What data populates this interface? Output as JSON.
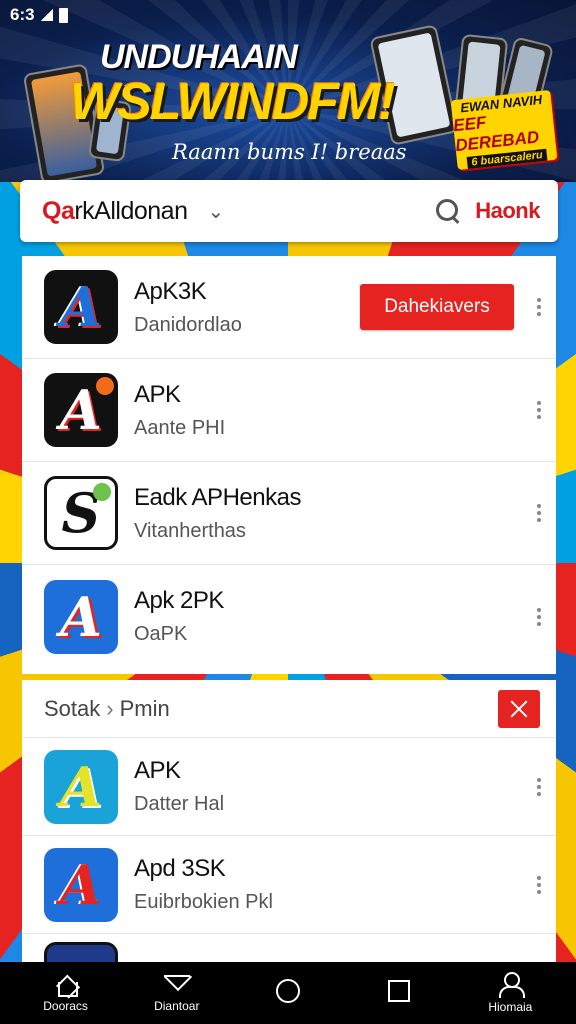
{
  "status_bar": {
    "time": "6:3"
  },
  "banner": {
    "title": "UNDUHAAIN",
    "headline": "WSLWINDFM!",
    "subtitle": "Raann bums I! breaas",
    "badge": {
      "line1": "EWAN NAVIH",
      "line2": "EEF DEREBAD",
      "line3": "6 buarscaleru"
    }
  },
  "search_bar": {
    "brand_red": "Qa",
    "brand_rest": "rkAlldonan",
    "action_label": "Haonk"
  },
  "apps_top": [
    {
      "title": "ApK3K",
      "subtitle": "Danidordlao",
      "icon_bg": "#111111",
      "icon_fg": "#1e6fd9",
      "icon_glyph": "A",
      "dot": "",
      "button": "Dahekiavers"
    },
    {
      "title": "APK",
      "subtitle": "Aante  PHI",
      "icon_bg": "#111111",
      "icon_fg": "#ffffff",
      "icon_glyph": "A",
      "dot": "#f26a1b",
      "button": ""
    },
    {
      "title": "Eadk APHenkas",
      "subtitle": "Vitanherthas",
      "icon_bg": "#ffffff",
      "icon_fg": "#111111",
      "icon_glyph": "S",
      "dot": "#6cc24a",
      "button": ""
    },
    {
      "title": "Apk 2PK",
      "subtitle": "OaPK",
      "icon_bg": "#1e6fd9",
      "icon_fg": "#ffffff",
      "icon_glyph": "A",
      "dot": "",
      "button": ""
    }
  ],
  "section": {
    "left": "Sotak",
    "right": "Pmin"
  },
  "apps_bottom": [
    {
      "title": "APK",
      "subtitle": "Datter Hal",
      "icon_bg": "#1aa3d9",
      "icon_fg": "#e3e32a",
      "icon_glyph": "A",
      "dot": ""
    },
    {
      "title": "Apd 3SK",
      "subtitle": "Euibrbokien Pkl",
      "icon_bg": "#1e6fd9",
      "icon_fg": "#e52421",
      "icon_glyph": "A",
      "dot": ""
    }
  ],
  "nav": [
    {
      "label": "Dooracs",
      "icon": "home-icon"
    },
    {
      "label": "Diantoar",
      "icon": "filter-icon"
    },
    {
      "label": "",
      "icon": "circle-icon"
    },
    {
      "label": "",
      "icon": "square-icon"
    },
    {
      "label": "Hiomaia",
      "icon": "user-icon"
    }
  ],
  "colors": {
    "accent": "#e52421",
    "banner_bg": "#0b1f4d",
    "highlight": "#ffd400"
  }
}
